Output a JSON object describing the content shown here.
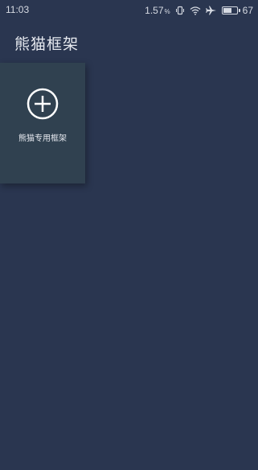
{
  "status_bar": {
    "time": "11:03",
    "net_speed": "1.57",
    "net_speed_unit": "%",
    "battery_level": 67,
    "battery_text": "67",
    "icons": [
      "vibrate-icon",
      "wifi-icon",
      "airplane-icon",
      "battery-icon"
    ]
  },
  "header": {
    "title": "熊猫框架"
  },
  "cards": [
    {
      "label": "熊猫专用框架",
      "icon": "add-circle-icon"
    }
  ],
  "colors": {
    "background": "#2a3650",
    "card": "#304150",
    "text": "#e6e9ef"
  }
}
